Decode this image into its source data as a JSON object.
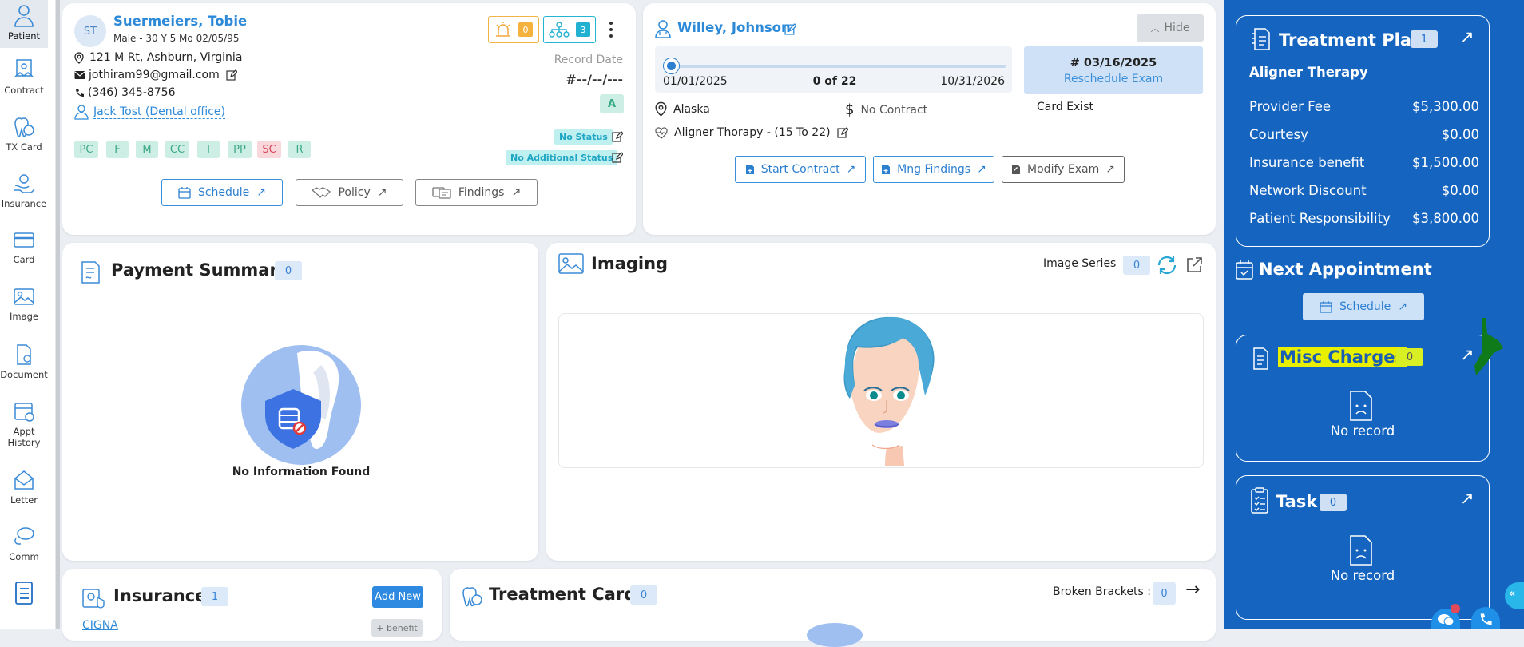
{
  "sidebar": {
    "items": [
      {
        "label": "Patient",
        "icon": "patient-icon"
      },
      {
        "label": "Contract",
        "icon": "contract-icon"
      },
      {
        "label": "TX Card",
        "icon": "tx-card-icon"
      },
      {
        "label": "Insurance",
        "icon": "insurance-icon"
      },
      {
        "label": "Card",
        "icon": "card-icon"
      },
      {
        "label": "Image",
        "icon": "image-icon"
      },
      {
        "label": "Document",
        "icon": "document-icon"
      },
      {
        "label": "Appt History",
        "icon": "appt-history-icon"
      },
      {
        "label": "Letter",
        "icon": "letter-icon"
      },
      {
        "label": "Comm",
        "icon": "comm-icon"
      }
    ]
  },
  "patient": {
    "initials": "ST",
    "name": "Suermeiers, Tobie",
    "demographics": "Male - 30 Y 5 Mo 02/05/95",
    "address": "121 M Rt, Ashburn, Virginia",
    "email": "jothiram99@gmail.com",
    "phone": "(346) 345-8756",
    "office": "Jack Tost (Dental office)",
    "alert_count": "0",
    "family_count": "3",
    "record_date_label": "Record Date",
    "record_date": "#--/--/---",
    "grade": "A",
    "status": "No Status",
    "additional_status": "No Additional Status",
    "tags": [
      {
        "t": "PC",
        "red": false
      },
      {
        "t": "F",
        "red": false
      },
      {
        "t": "M",
        "red": false
      },
      {
        "t": "CC",
        "red": false
      },
      {
        "t": "I",
        "red": false
      },
      {
        "t": "PP",
        "red": false
      },
      {
        "t": "SC",
        "red": true
      },
      {
        "t": "R",
        "red": false
      }
    ],
    "buttons": {
      "schedule": "Schedule",
      "policy": "Policy",
      "findings": "Findings"
    }
  },
  "doctor": {
    "name": "Willey, Johnson",
    "hide": "Hide",
    "start_date": "01/01/2025",
    "progress_text": "0 of 22",
    "end_date": "10/31/2026",
    "progress_value": 0,
    "exam_date": "# 03/16/2025",
    "reschedule": "Reschedule Exam",
    "location": "Alaska",
    "contract": "No Contract",
    "card_exist": "Card Exist",
    "therapy": "Aligner Thorapy - (15 To 22)",
    "buttons": {
      "start_contract": "Start Contract",
      "mng_findings": "Mng Findings",
      "modify_exam": "Modify Exam"
    }
  },
  "payment": {
    "title": "Payment Summary",
    "count": "0",
    "empty": "No Information Found"
  },
  "imaging": {
    "title": "Imaging",
    "series_label": "Image Series",
    "series_count": "0"
  },
  "insurance": {
    "title": "Insurance",
    "count": "1",
    "add": "Add New",
    "first": "CIGNA",
    "benefit": "+ benefit"
  },
  "treatment_card": {
    "title": "Treatment Card",
    "count": "0",
    "broken_label": "Broken Brackets :",
    "broken_count": "0"
  },
  "treatment_plan": {
    "title": "Treatment Plan",
    "count": "1",
    "therapy": "Aligner Therapy",
    "rows": [
      {
        "label": "Provider Fee",
        "value": "$5,300.00"
      },
      {
        "label": "Courtesy",
        "value": "$0.00"
      },
      {
        "label": "Insurance benefit",
        "value": "$1,500.00"
      },
      {
        "label": "Network Discount",
        "value": "$0.00"
      },
      {
        "label": "Patient Responsibility",
        "value": "$3,800.00"
      }
    ]
  },
  "next_appointment": {
    "title": "Next Appointment",
    "schedule": "Schedule"
  },
  "misc": {
    "title": "Misc Charges",
    "count": "0",
    "empty": "No record"
  },
  "task": {
    "title": "Task",
    "count": "0",
    "empty": "No record"
  },
  "colors": {
    "accent": "#1565c0",
    "link": "#2d8ad8",
    "tag_bg": "#cdeee5",
    "highlight": "#e8f000"
  }
}
